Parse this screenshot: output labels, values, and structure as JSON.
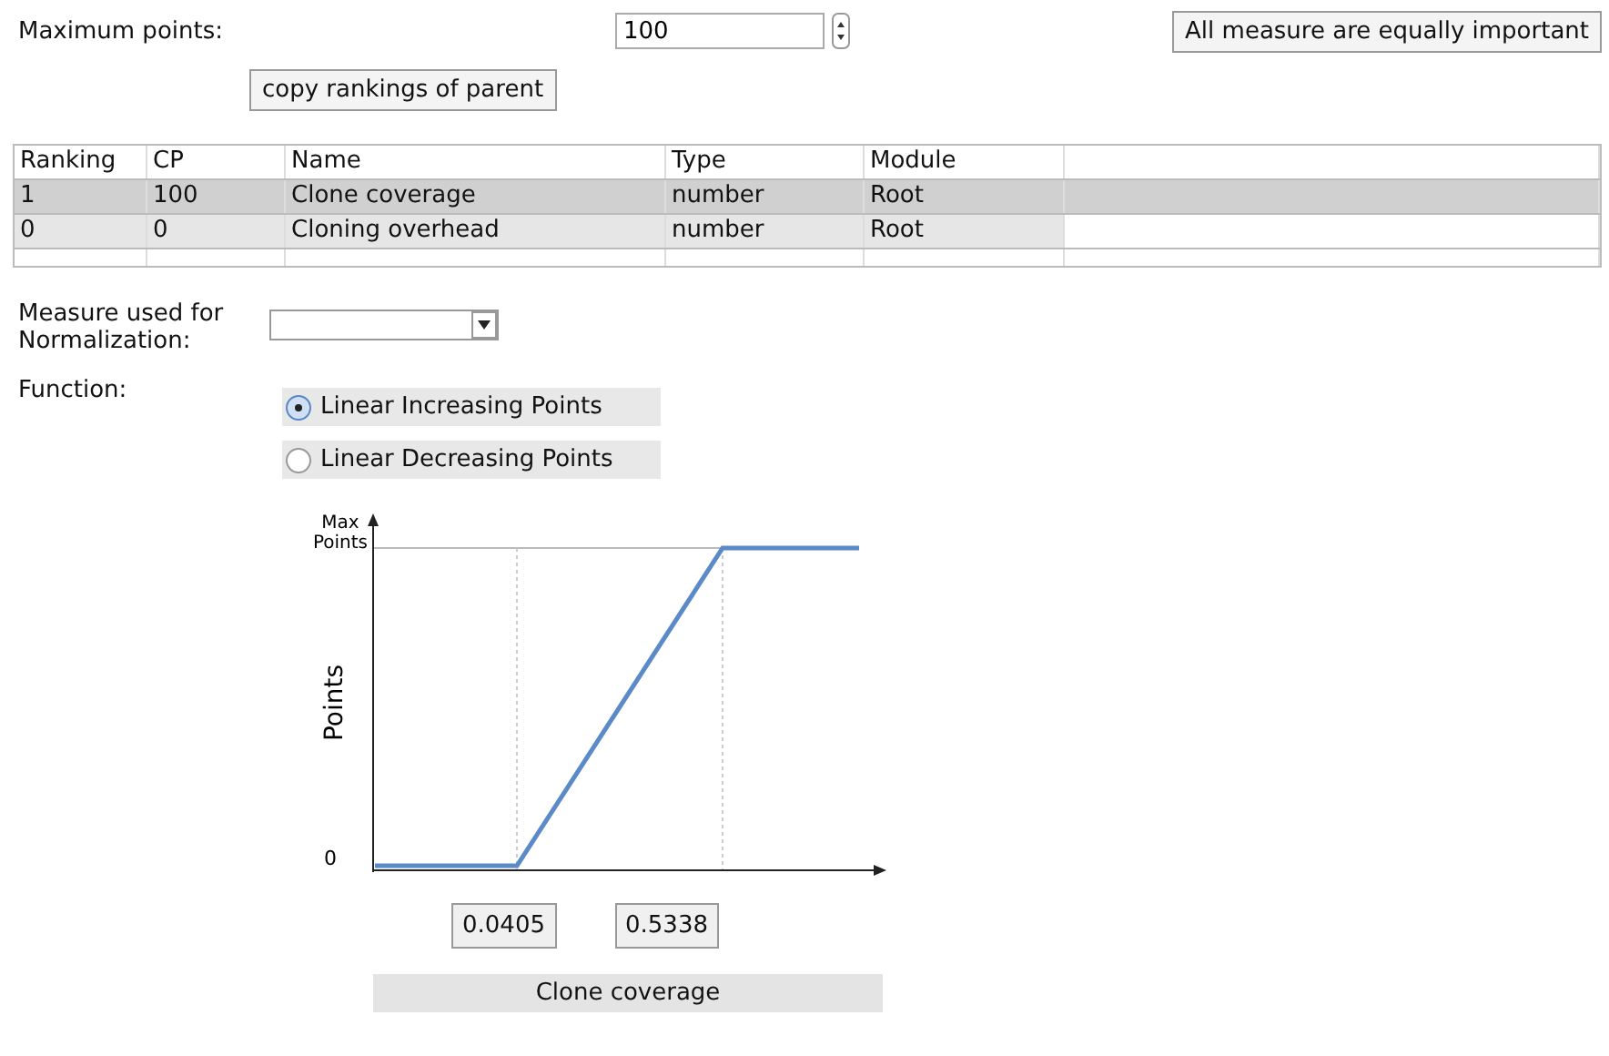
{
  "maximum_points": {
    "label": "Maximum points:",
    "value": "100"
  },
  "equal_button": "All measure are equally important",
  "copy_button": "copy rankings of parent",
  "table": {
    "columns": [
      "Ranking",
      "CP",
      "Name",
      "Type",
      "Module"
    ],
    "rows": [
      {
        "cells": [
          "1",
          "100",
          "Clone coverage",
          "number",
          "Root"
        ],
        "selected": true
      },
      {
        "cells": [
          "0",
          "0",
          "Cloning overhead",
          "number",
          "Root"
        ],
        "selected": false
      }
    ]
  },
  "normalization": {
    "label": "Measure used for Normalization:"
  },
  "function": {
    "label": "Function:",
    "options": [
      {
        "label": "Linear Increasing Points",
        "selected": true
      },
      {
        "label": "Linear Decreasing Points",
        "selected": false
      }
    ]
  },
  "graph": {
    "y_top_label": "Max Points",
    "y_zero_label": "0",
    "y_axis_title": "Points",
    "thresholds": [
      "0.0405",
      "0.5338"
    ],
    "measure": "Clone coverage"
  }
}
